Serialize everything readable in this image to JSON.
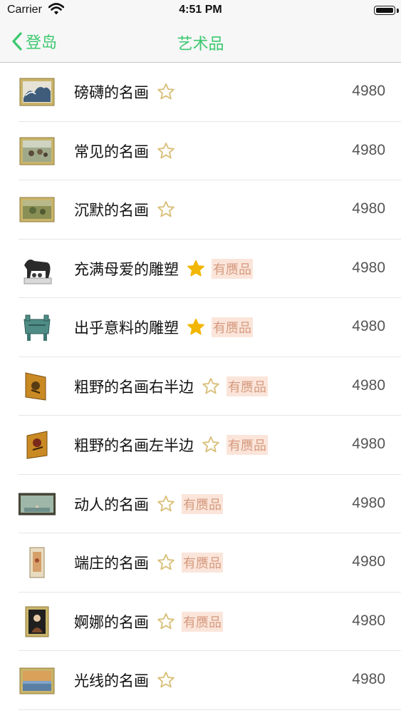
{
  "status_bar": {
    "carrier": "Carrier",
    "time": "4:51 PM"
  },
  "nav": {
    "back_label": "登岛",
    "title": "艺术品",
    "accent_color": "#3cc96f"
  },
  "items": [
    {
      "name": "磅礴的名画",
      "starred": false,
      "badge": "",
      "price": "4980",
      "thumb": "painting-wave"
    },
    {
      "name": "常见的名画",
      "starred": false,
      "badge": "",
      "price": "4980",
      "thumb": "painting-gleaners"
    },
    {
      "name": "沉默的名画",
      "starred": false,
      "badge": "",
      "price": "4980",
      "thumb": "painting-landscape"
    },
    {
      "name": "充满母爱的雕塑",
      "starred": true,
      "badge": "有赝品",
      "price": "4980",
      "thumb": "statue-wolf"
    },
    {
      "name": "出乎意料的雕塑",
      "starred": true,
      "badge": "有赝品",
      "price": "4980",
      "thumb": "statue-cauldron"
    },
    {
      "name": "粗野的名画右半边",
      "starred": false,
      "badge": "有赝品",
      "price": "4980",
      "thumb": "screen-right"
    },
    {
      "name": "粗野的名画左半边",
      "starred": false,
      "badge": "有赝品",
      "price": "4980",
      "thumb": "screen-left"
    },
    {
      "name": "动人的名画",
      "starred": false,
      "badge": "有赝品",
      "price": "4980",
      "thumb": "painting-venus"
    },
    {
      "name": "端庄的名画",
      "starred": false,
      "badge": "有赝品",
      "price": "4980",
      "thumb": "painting-scroll"
    },
    {
      "name": "婀娜的名画",
      "starred": false,
      "badge": "有赝品",
      "price": "4980",
      "thumb": "painting-lady"
    },
    {
      "name": "光线的名画",
      "starred": false,
      "badge": "",
      "price": "4980",
      "thumb": "painting-light"
    }
  ]
}
